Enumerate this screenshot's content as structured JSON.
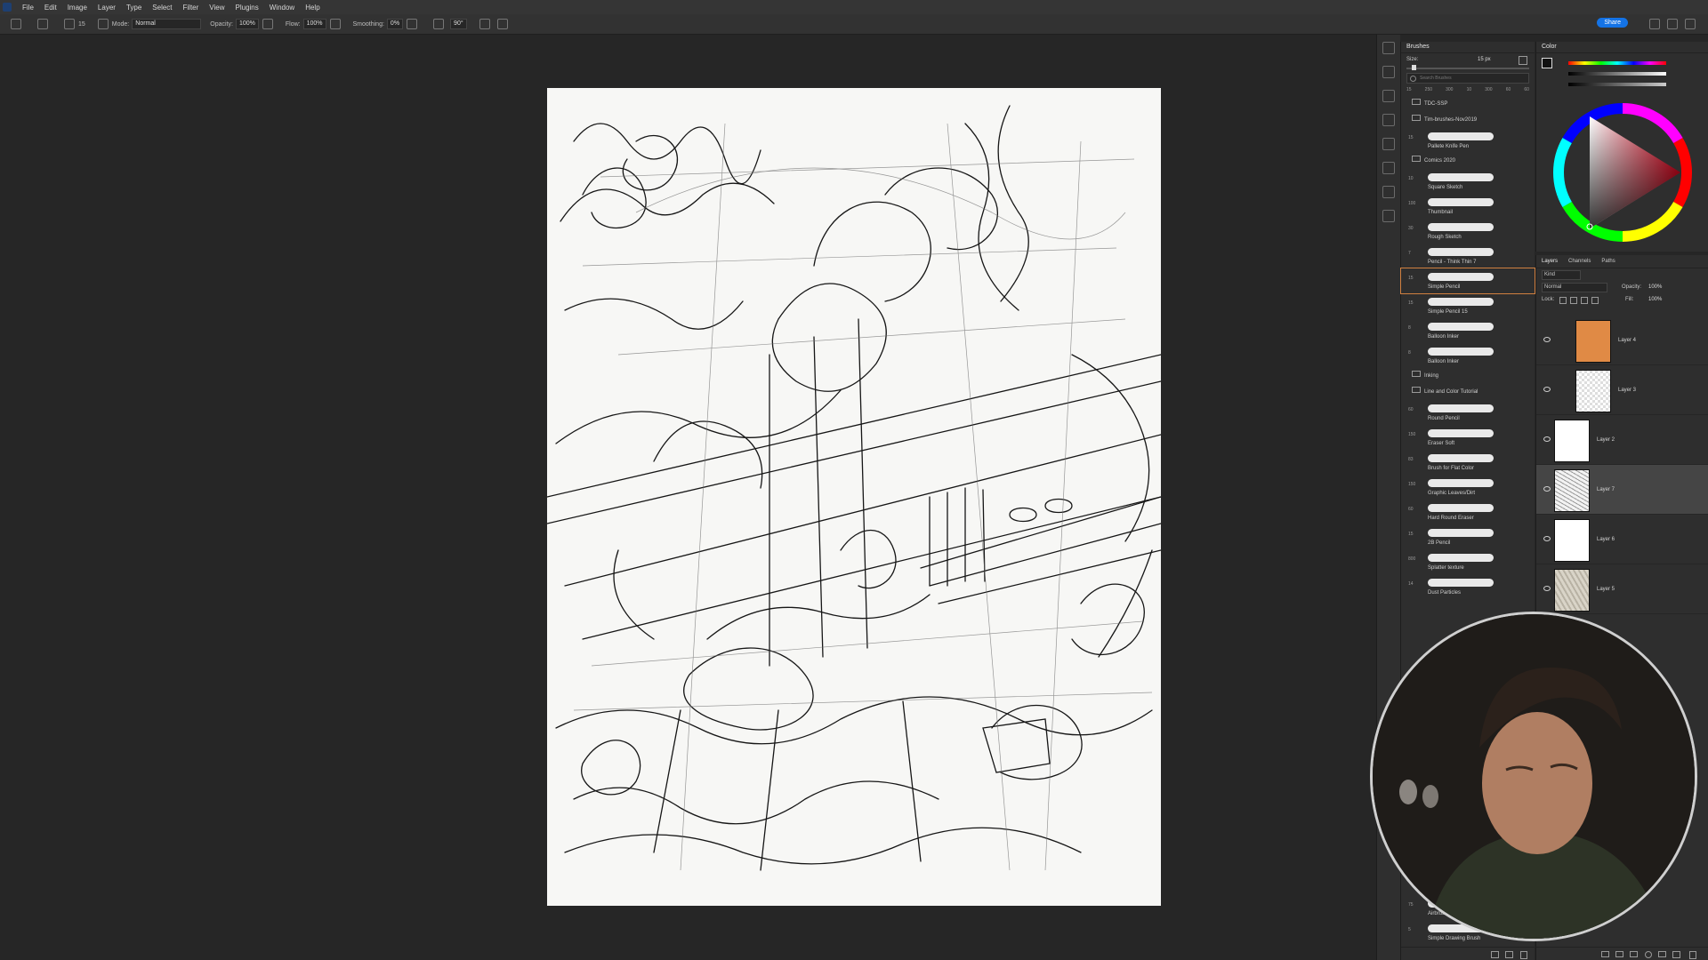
{
  "menu": [
    "File",
    "Edit",
    "Image",
    "Layer",
    "Type",
    "Select",
    "Filter",
    "View",
    "Plugins",
    "Window",
    "Help"
  ],
  "options": {
    "mode_label": "Mode:",
    "mode_value": "Normal",
    "opacity_label": "Opacity:",
    "opacity_value": "100%",
    "flow_label": "Flow:",
    "flow_value": "100%",
    "smoothing_label": "Smoothing:",
    "smoothing_value": "0%",
    "angle_value": "90°",
    "brush_size_small": "15"
  },
  "share_label": "Share",
  "brushes_panel": {
    "title": "Brushes",
    "size_label": "Size:",
    "size_value": "15 px",
    "search_placeholder": "Search Brushes",
    "preset_sizes": [
      "15",
      "250",
      "300",
      "10",
      "300",
      "60",
      "60"
    ],
    "folders_top": [
      "TDC-SSP",
      "Tim-brushes-Nov2019"
    ],
    "top_brush": {
      "num": "15",
      "name": "Pallete Knife Pen"
    },
    "comics_folder": "Comics 2020",
    "comics_brushes": [
      {
        "num": "10",
        "name": "Square Sketch"
      },
      {
        "num": "100",
        "name": "Thumbnail"
      },
      {
        "num": "30",
        "name": "Rough Sketch"
      },
      {
        "num": "7",
        "name": "Pencil - Think Thin 7"
      },
      {
        "num": "15",
        "name": "Simple Pencil"
      },
      {
        "num": "15",
        "name": "Simple Pencil 15"
      },
      {
        "num": "8",
        "name": "Balloon Inker"
      },
      {
        "num": "8",
        "name": "Balloon Inker"
      }
    ],
    "inking_folder": "Inking",
    "tutorial_folder": "Line and Color Tutorial",
    "tutorial_brushes": [
      {
        "num": "60",
        "name": "Round Pencil"
      },
      {
        "num": "150",
        "name": "Eraser Soft"
      },
      {
        "num": "83",
        "name": "Brush for Flat Color"
      },
      {
        "num": "150",
        "name": "Graphic Leaves/Dirt"
      },
      {
        "num": "60",
        "name": "Hard Round Eraser"
      },
      {
        "num": "15",
        "name": "2B Pencil"
      },
      {
        "num": "800",
        "name": "Splatter texture"
      },
      {
        "num": "14",
        "name": "Dust Particles"
      }
    ],
    "bottom_brushes": [
      {
        "num": "75",
        "name": "Airbrush"
      },
      {
        "num": "5",
        "name": "Simple Drawing Brush"
      }
    ]
  },
  "color_panel": {
    "title": "Color"
  },
  "layers_panel": {
    "tabs": [
      "Layers",
      "Channels",
      "Paths"
    ],
    "kind_label": "Kind",
    "blend_mode": "Normal",
    "opacity_label": "Opacity:",
    "opacity_value": "100%",
    "lock_label": "Lock:",
    "fill_label": "Fill:",
    "fill_value": "100%",
    "layers": [
      {
        "name": "Layer 4",
        "thumb": "#e08a45"
      },
      {
        "name": "Layer 3",
        "thumb": "checker"
      },
      {
        "name": "Layer 2",
        "thumb": "#ffffff"
      },
      {
        "name": "Layer 7",
        "thumb": "sketch"
      },
      {
        "name": "Layer 6",
        "thumb": "#ffffff"
      },
      {
        "name": "Layer 5",
        "thumb": "texture"
      }
    ],
    "selected_index": 3
  },
  "colors": {
    "accent": "#1473e6",
    "selected_brush": "#d08040"
  }
}
